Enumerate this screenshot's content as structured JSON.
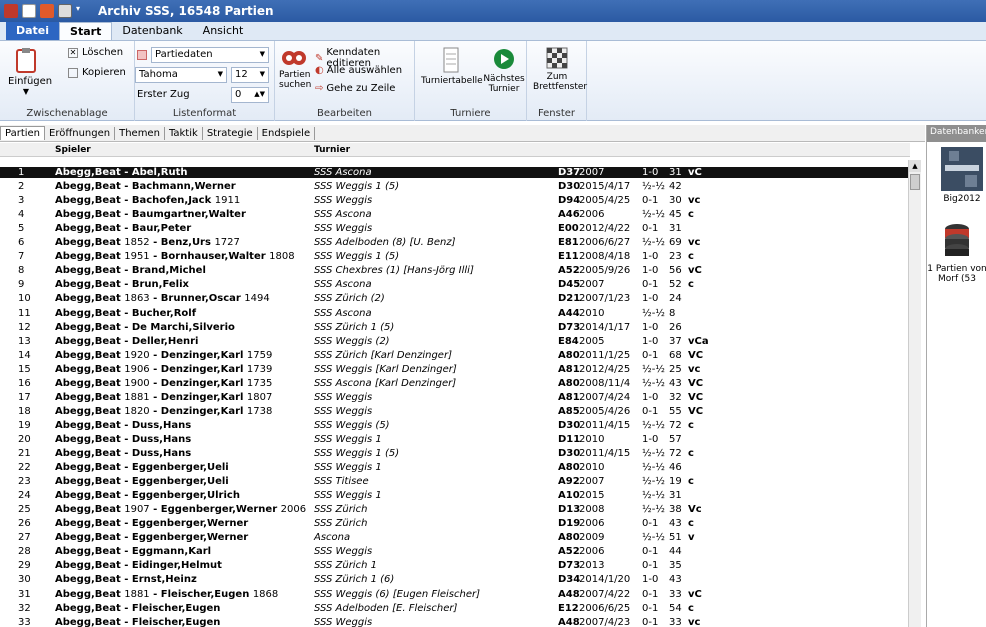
{
  "window": {
    "title": "Archiv SSS,  16548 Partien"
  },
  "tabs": [
    "Datei",
    "Start",
    "Datenbank",
    "Ansicht"
  ],
  "ribbon": {
    "clipboard": {
      "paste": "Einfügen",
      "delete": "Löschen",
      "copy": "Kopieren",
      "label": "Zwischenablage"
    },
    "listformat": {
      "mode": "Partiedaten",
      "font": "Tahoma",
      "size": "12",
      "first_move_label": "Erster Zug",
      "first_move_value": "0",
      "label": "Listenformat"
    },
    "edit": {
      "search": "Partien suchen",
      "edit_keys": "Kenndaten editieren",
      "select_all": "Alle auswählen",
      "goto_row": "Gehe zu Zeile",
      "label": "Bearbeiten"
    },
    "tournaments": {
      "table": "Turniertabelle",
      "next": "Nächstes Turnier",
      "label": "Turniere"
    },
    "window": {
      "board": "Zum Brettfenster",
      "label": "Fenster"
    }
  },
  "subtabs": [
    "Partien",
    "Eröffnungen",
    "Themen",
    "Taktik",
    "Strategie",
    "Endspiele"
  ],
  "columns": {
    "player": "Spieler",
    "tournament": "Turnier"
  },
  "rows": [
    {
      "n": "1",
      "white": "Abegg,Beat",
      "wy": "",
      "black": "Abel,Ruth",
      "by": "",
      "tour": "SSS Ascona",
      "eco": "D37",
      "date": "2007",
      "res": "1-0",
      "moves": "31",
      "ann": "vC"
    },
    {
      "n": "2",
      "white": "Abegg,Beat",
      "wy": "",
      "black": "Bachmann,Werner",
      "by": "",
      "tour": "SSS Weggis 1 (5)",
      "eco": "D30",
      "date": "2015/4/17",
      "res": "½-½",
      "moves": "42",
      "ann": ""
    },
    {
      "n": "3",
      "white": "Abegg,Beat",
      "wy": "",
      "black": "Bachofen,Jack",
      "by": "1911",
      "tour": "SSS Weggis",
      "eco": "D94",
      "date": "2005/4/25",
      "res": "0-1",
      "moves": "30",
      "ann": "vc"
    },
    {
      "n": "4",
      "white": "Abegg,Beat",
      "wy": "",
      "black": "Baumgartner,Walter",
      "by": "",
      "tour": "SSS Ascona",
      "eco": "A46",
      "date": "2006",
      "res": "½-½",
      "moves": "45",
      "ann": "c"
    },
    {
      "n": "5",
      "white": "Abegg,Beat",
      "wy": "",
      "black": "Baur,Peter",
      "by": "",
      "tour": "SSS Weggis",
      "eco": "E00",
      "date": "2012/4/22",
      "res": "0-1",
      "moves": "31",
      "ann": ""
    },
    {
      "n": "6",
      "white": "Abegg,Beat",
      "wy": "1852",
      "black": "Benz,Urs",
      "by": "1727",
      "tour": "SSS Adelboden (8) [U. Benz]",
      "eco": "E81",
      "date": "2006/6/27",
      "res": "½-½",
      "moves": "69",
      "ann": "vc"
    },
    {
      "n": "7",
      "white": "Abegg,Beat",
      "wy": "1951",
      "black": "Bornhauser,Walter",
      "by": "1808",
      "tour": "SSS Weggis 1 (5)",
      "eco": "E11",
      "date": "2008/4/18",
      "res": "1-0",
      "moves": "23",
      "ann": "c"
    },
    {
      "n": "8",
      "white": "Abegg,Beat",
      "wy": "",
      "black": "Brand,Michel",
      "by": "",
      "tour": "SSS Chexbres (1) [Hans-Jörg Illi]",
      "eco": "A52",
      "date": "2005/9/26",
      "res": "1-0",
      "moves": "56",
      "ann": "vC"
    },
    {
      "n": "9",
      "white": "Abegg,Beat",
      "wy": "",
      "black": "Brun,Felix",
      "by": "",
      "tour": "SSS Ascona",
      "eco": "D45",
      "date": "2007",
      "res": "0-1",
      "moves": "52",
      "ann": "c"
    },
    {
      "n": "10",
      "white": "Abegg,Beat",
      "wy": "1863",
      "black": "Brunner,Oscar",
      "by": "1494",
      "tour": "SSS Zürich (2)",
      "eco": "D21",
      "date": "2007/1/23",
      "res": "1-0",
      "moves": "24",
      "ann": ""
    },
    {
      "n": "11",
      "white": "Abegg,Beat",
      "wy": "",
      "black": "Bucher,Rolf",
      "by": "",
      "tour": "SSS Ascona",
      "eco": "A44",
      "date": "2010",
      "res": "½-½",
      "moves": "8",
      "ann": ""
    },
    {
      "n": "12",
      "white": "Abegg,Beat",
      "wy": "",
      "black": "De Marchi,Silverio",
      "by": "",
      "tour": "SSS Zürich 1 (5)",
      "eco": "D73",
      "date": "2014/1/17",
      "res": "1-0",
      "moves": "26",
      "ann": ""
    },
    {
      "n": "13",
      "white": "Abegg,Beat",
      "wy": "",
      "black": "Deller,Henri",
      "by": "",
      "tour": "SSS Weggis (2)",
      "eco": "E84",
      "date": "2005",
      "res": "1-0",
      "moves": "37",
      "ann": "vCa"
    },
    {
      "n": "14",
      "white": "Abegg,Beat",
      "wy": "1920",
      "black": "Denzinger,Karl",
      "by": "1759",
      "tour": "SSS Zürich [Karl Denzinger]",
      "eco": "A80",
      "date": "2011/1/25",
      "res": "0-1",
      "moves": "68",
      "ann": "VC"
    },
    {
      "n": "15",
      "white": "Abegg,Beat",
      "wy": "1906",
      "black": "Denzinger,Karl",
      "by": "1739",
      "tour": "SSS Weggis [Karl Denzinger]",
      "eco": "A81",
      "date": "2012/4/25",
      "res": "½-½",
      "moves": "25",
      "ann": "vc"
    },
    {
      "n": "16",
      "white": "Abegg,Beat",
      "wy": "1900",
      "black": "Denzinger,Karl",
      "by": "1735",
      "tour": "SSS Ascona [Karl Denzinger]",
      "eco": "A80",
      "date": "2008/11/4",
      "res": "½-½",
      "moves": "43",
      "ann": "VC"
    },
    {
      "n": "17",
      "white": "Abegg,Beat",
      "wy": "1881",
      "black": "Denzinger,Karl",
      "by": "1807",
      "tour": "SSS Weggis",
      "eco": "A81",
      "date": "2007/4/24",
      "res": "1-0",
      "moves": "32",
      "ann": "VC"
    },
    {
      "n": "18",
      "white": "Abegg,Beat",
      "wy": "1820",
      "black": "Denzinger,Karl",
      "by": "1738",
      "tour": "SSS Weggis",
      "eco": "A85",
      "date": "2005/4/26",
      "res": "0-1",
      "moves": "55",
      "ann": "VC"
    },
    {
      "n": "19",
      "white": "Abegg,Beat",
      "wy": "",
      "black": "Duss,Hans",
      "by": "",
      "tour": "SSS Weggis (5)",
      "eco": "D30",
      "date": "2011/4/15",
      "res": "½-½",
      "moves": "72",
      "ann": "c"
    },
    {
      "n": "20",
      "white": "Abegg,Beat",
      "wy": "",
      "black": "Duss,Hans",
      "by": "",
      "tour": "SSS Weggis 1",
      "eco": "D11",
      "date": "2010",
      "res": "1-0",
      "moves": "57",
      "ann": ""
    },
    {
      "n": "21",
      "white": "Abegg,Beat",
      "wy": "",
      "black": "Duss,Hans",
      "by": "",
      "tour": "SSS Weggis 1 (5)",
      "eco": "D30",
      "date": "2011/4/15",
      "res": "½-½",
      "moves": "72",
      "ann": "c"
    },
    {
      "n": "22",
      "white": "Abegg,Beat",
      "wy": "",
      "black": "Eggenberger,Ueli",
      "by": "",
      "tour": "SSS Weggis 1",
      "eco": "A80",
      "date": "2010",
      "res": "½-½",
      "moves": "46",
      "ann": ""
    },
    {
      "n": "23",
      "white": "Abegg,Beat",
      "wy": "",
      "black": "Eggenberger,Ueli",
      "by": "",
      "tour": "SSS Titisee",
      "eco": "A92",
      "date": "2007",
      "res": "½-½",
      "moves": "19",
      "ann": "c"
    },
    {
      "n": "24",
      "white": "Abegg,Beat",
      "wy": "",
      "black": "Eggenberger,Ulrich",
      "by": "",
      "tour": "SSS Weggis 1",
      "eco": "A10",
      "date": "2015",
      "res": "½-½",
      "moves": "31",
      "ann": ""
    },
    {
      "n": "25",
      "white": "Abegg,Beat",
      "wy": "1907",
      "black": "Eggenberger,Werner",
      "by": "2006",
      "tour": "SSS Zürich",
      "eco": "D13",
      "date": "2008",
      "res": "½-½",
      "moves": "38",
      "ann": "Vc"
    },
    {
      "n": "26",
      "white": "Abegg,Beat",
      "wy": "",
      "black": "Eggenberger,Werner",
      "by": "",
      "tour": "SSS Zürich",
      "eco": "D19",
      "date": "2006",
      "res": "0-1",
      "moves": "43",
      "ann": "c"
    },
    {
      "n": "27",
      "white": "Abegg,Beat",
      "wy": "",
      "black": "Eggenberger,Werner",
      "by": "",
      "tour": "Ascona",
      "eco": "A80",
      "date": "2009",
      "res": "½-½",
      "moves": "51",
      "ann": "v"
    },
    {
      "n": "28",
      "white": "Abegg,Beat",
      "wy": "",
      "black": "Eggmann,Karl",
      "by": "",
      "tour": "SSS Weggis",
      "eco": "A52",
      "date": "2006",
      "res": "0-1",
      "moves": "44",
      "ann": ""
    },
    {
      "n": "29",
      "white": "Abegg,Beat",
      "wy": "",
      "black": "Eidinger,Helmut",
      "by": "",
      "tour": "SSS Zürich 1",
      "eco": "D73",
      "date": "2013",
      "res": "0-1",
      "moves": "35",
      "ann": ""
    },
    {
      "n": "30",
      "white": "Abegg,Beat",
      "wy": "",
      "black": "Ernst,Heinz",
      "by": "",
      "tour": "SSS Zürich 1 (6)",
      "eco": "D34",
      "date": "2014/1/20",
      "res": "1-0",
      "moves": "43",
      "ann": ""
    },
    {
      "n": "31",
      "white": "Abegg,Beat",
      "wy": "1881",
      "black": "Fleischer,Eugen",
      "by": "1868",
      "tour": "SSS Weggis (6) [Eugen Fleischer]",
      "eco": "A48",
      "date": "2007/4/22",
      "res": "0-1",
      "moves": "33",
      "ann": "vC"
    },
    {
      "n": "32",
      "white": "Abegg,Beat",
      "wy": "",
      "black": "Fleischer,Eugen",
      "by": "",
      "tour": "SSS Adelboden [E. Fleischer]",
      "eco": "E12",
      "date": "2006/6/25",
      "res": "0-1",
      "moves": "54",
      "ann": "c"
    },
    {
      "n": "33",
      "white": "Abegg,Beat",
      "wy": "",
      "black": "Fleischer,Eugen",
      "by": "",
      "tour": "SSS Weggis",
      "eco": "A48",
      "date": "2007/4/23",
      "res": "0-1",
      "moves": "33",
      "ann": "vc"
    }
  ],
  "selected_row": "1",
  "right_panel": {
    "header": "Datenbanken",
    "db1_label": "Big2012",
    "db2_label1": "1 Partien von",
    "db2_label2": "Morf (53"
  },
  "colors": {
    "titlebar": "#2b5aa3",
    "selection": "#111111",
    "file_tab": "#2d66c2"
  }
}
